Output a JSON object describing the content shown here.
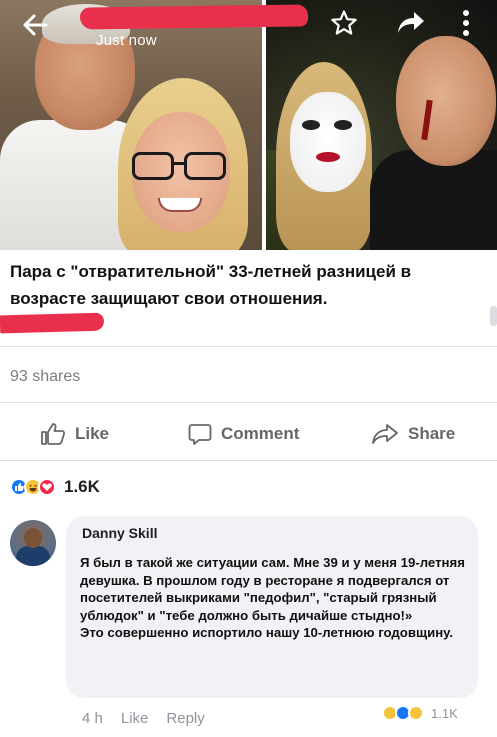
{
  "header": {
    "post_time": "Just now"
  },
  "post": {
    "headline": "Пара с \"отвратительной\" 33-летней разницей в возрасте защищают свои отношения.",
    "shares": "93 shares"
  },
  "actions": {
    "like": "Like",
    "comment": "Comment",
    "share": "Share"
  },
  "reactions": {
    "count": "1.6K",
    "types": [
      "like",
      "haha",
      "love"
    ]
  },
  "comment": {
    "author": "Danny Skill",
    "text": "Я был в такой же ситуации сам. Мне 39 и у меня 19-летняя девушка. В прошлом году в ресторане я подвергался от посетителей выкриками \"педофил\", \"старый грязный ублюдок\" и \"тебе должно быть дичайше стыдно!»\nЭто совершенно испортило нашу 10-летнюю годовщину.",
    "time": "4 h",
    "like": "Like",
    "reply": "Reply",
    "reaction_count": "1.1K",
    "reaction_types": [
      "haha",
      "like",
      "wow"
    ]
  },
  "colors": {
    "redaction": "#e8304c",
    "like_blue": "#1877f2",
    "muted_text": "#65676b"
  }
}
